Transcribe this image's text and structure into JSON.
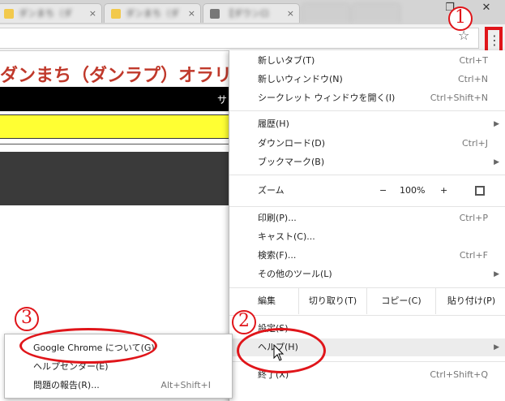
{
  "tabs": [
    {
      "label": "ダンまち（ダ",
      "close": "×"
    },
    {
      "label": "ダンまち（ダ",
      "close": "×"
    },
    {
      "label": "【ダウンロ",
      "close": "×"
    },
    {
      "label": "",
      "close": ""
    },
    {
      "label": "",
      "close": ""
    }
  ],
  "window_controls": {
    "restore": "❐",
    "close": "✕"
  },
  "toolbar": {
    "star": "☆",
    "menu": "⋮"
  },
  "page": {
    "title": "ダンまち（ダンラプ）オラリオ",
    "blackbar_text": "サ"
  },
  "menu": {
    "items": [
      {
        "label": "新しいタブ(T)",
        "shortcut": "Ctrl+T"
      },
      {
        "label": "新しいウィンドウ(N)",
        "shortcut": "Ctrl+N"
      },
      {
        "label": "シークレット ウィンドウを開く(I)",
        "shortcut": "Ctrl+Shift+N"
      },
      {
        "label": "履歴(H)",
        "shortcut": ""
      },
      {
        "label": "ダウンロード(D)",
        "shortcut": "Ctrl+J"
      },
      {
        "label": "ブックマーク(B)",
        "shortcut": ""
      },
      {
        "label": "印刷(P)...",
        "shortcut": "Ctrl+P"
      },
      {
        "label": "キャスト(C)...",
        "shortcut": ""
      },
      {
        "label": "検索(F)...",
        "shortcut": "Ctrl+F"
      },
      {
        "label": "その他のツール(L)",
        "shortcut": ""
      },
      {
        "label": "設定(S)",
        "shortcut": ""
      },
      {
        "label": "ヘルプ(H)",
        "shortcut": ""
      },
      {
        "label": "終了(X)",
        "shortcut": "Ctrl+Shift+Q"
      }
    ],
    "zoom": {
      "label": "ズーム",
      "minus": "−",
      "value": "100%",
      "plus": "+"
    },
    "edit": {
      "label": "編集",
      "cut": "切り取り(T)",
      "copy": "コピー(C)",
      "paste": "貼り付け(P)"
    },
    "arrow": "▶"
  },
  "submenu": {
    "items": [
      {
        "label": "Google Chrome について(G)",
        "shortcut": ""
      },
      {
        "label": "ヘルプセンター(E)",
        "shortcut": ""
      },
      {
        "label": "問題の報告(R)...",
        "shortcut": "Alt+Shift+I"
      }
    ]
  },
  "annotations": {
    "n1": "1",
    "n2": "2",
    "n3": "3",
    "color": "#e0151a"
  }
}
